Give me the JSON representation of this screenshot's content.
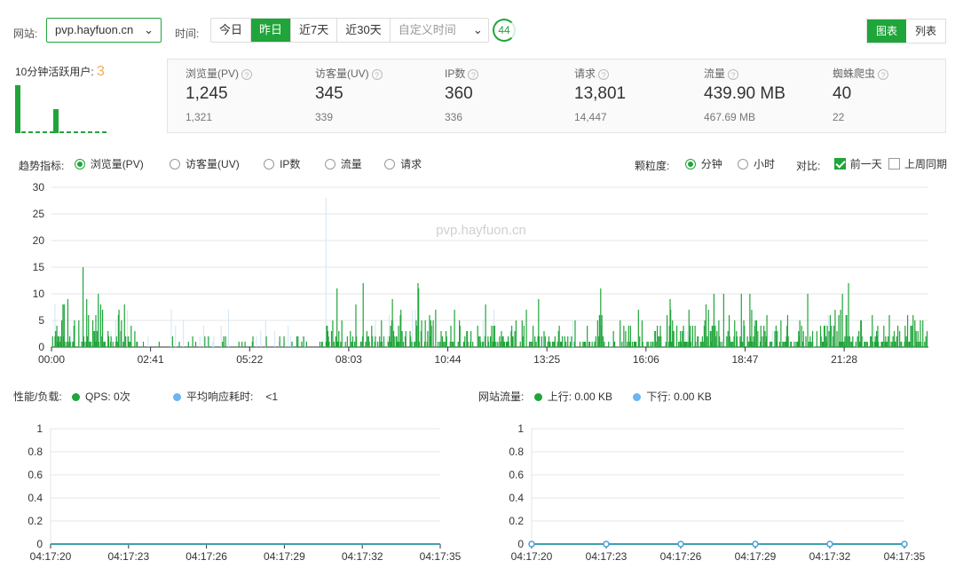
{
  "filters": {
    "site_label": "网站:",
    "site_value": "pvp.hayfuon.cn",
    "time_label": "时间:",
    "time_options": [
      "今日",
      "昨日",
      "近7天",
      "近30天"
    ],
    "time_active": "昨日",
    "custom_time_placeholder": "自定义时间",
    "refresh_countdown": "44",
    "view_options": [
      "图表",
      "列表"
    ],
    "view_active": "图表"
  },
  "active_users": {
    "label": "10分钟活跃用户:",
    "count": "3",
    "bars": [
      0,
      0,
      0,
      0,
      0,
      0,
      0
    ]
  },
  "stats": [
    {
      "title": "浏览量(PV)",
      "value": "1,245",
      "previous": "1,321"
    },
    {
      "title": "访客量(UV)",
      "value": "345",
      "previous": "339"
    },
    {
      "title": "IP数",
      "value": "360",
      "previous": "336"
    },
    {
      "title": "请求",
      "value": "13,801",
      "previous": "14,447"
    },
    {
      "title": "流量",
      "value": "439.90 MB",
      "previous": "467.69 MB"
    },
    {
      "title": "蜘蛛爬虫",
      "value": "40",
      "previous": "22"
    }
  ],
  "trend_controls": {
    "metric_label": "趋势指标:",
    "metrics": [
      "浏览量(PV)",
      "访客量(UV)",
      "IP数",
      "流量",
      "请求"
    ],
    "metric_selected": "浏览量(PV)",
    "granularity_label": "颗粒度:",
    "granularity_options": [
      "分钟",
      "小时"
    ],
    "granularity_selected": "分钟",
    "compare_label": "对比:",
    "compare_options": [
      {
        "label": "前一天",
        "checked": true
      },
      {
        "label": "上周同期",
        "checked": false
      }
    ]
  },
  "chart_data": [
    {
      "type": "bar",
      "title": "",
      "watermark": "pvp.hayfuon.cn",
      "ylim": [
        0,
        30
      ],
      "y_ticks": [
        "0",
        "5",
        "10",
        "15",
        "20",
        "25",
        "30"
      ],
      "x_ticks": [
        "00:00",
        "02:41",
        "05:22",
        "08:03",
        "10:44",
        "13:25",
        "16:06",
        "18:47",
        "21:28"
      ],
      "series": [
        {
          "name": "浏览量(PV)",
          "color": "#20a53a",
          "peak": 15
        },
        {
          "name": "前一天",
          "color": "#cfe6f7",
          "peak": 28
        }
      ]
    },
    {
      "type": "line",
      "legend": [
        {
          "label": "QPS: 0次",
          "color": "#20a53a"
        },
        {
          "label": "平均响应耗时:",
          "value": "<1",
          "color": "#6cb4f2"
        }
      ],
      "title_label": "性能/负载:",
      "ylim": [
        0,
        1
      ],
      "y_ticks": [
        "0",
        "0.2",
        "0.4",
        "0.6",
        "0.8",
        "1"
      ],
      "x_ticks": [
        "04:17:20",
        "04:17:23",
        "04:17:26",
        "04:17:29",
        "04:17:32",
        "04:17:35"
      ],
      "values": [
        0,
        0,
        0,
        0,
        0,
        0
      ]
    },
    {
      "type": "line",
      "title_label": "网站流量:",
      "legend": [
        {
          "label": "上行: 0.00 KB",
          "color": "#20a53a"
        },
        {
          "label": "下行: 0.00 KB",
          "color": "#6cb4f2"
        }
      ],
      "ylim": [
        0,
        1
      ],
      "y_ticks": [
        "0",
        "0.2",
        "0.4",
        "0.6",
        "0.8",
        "1"
      ],
      "x_ticks": [
        "04:17:20",
        "04:17:23",
        "04:17:26",
        "04:17:29",
        "04:17:32",
        "04:17:35"
      ],
      "values": [
        0,
        0,
        0,
        0,
        0,
        0
      ]
    }
  ]
}
